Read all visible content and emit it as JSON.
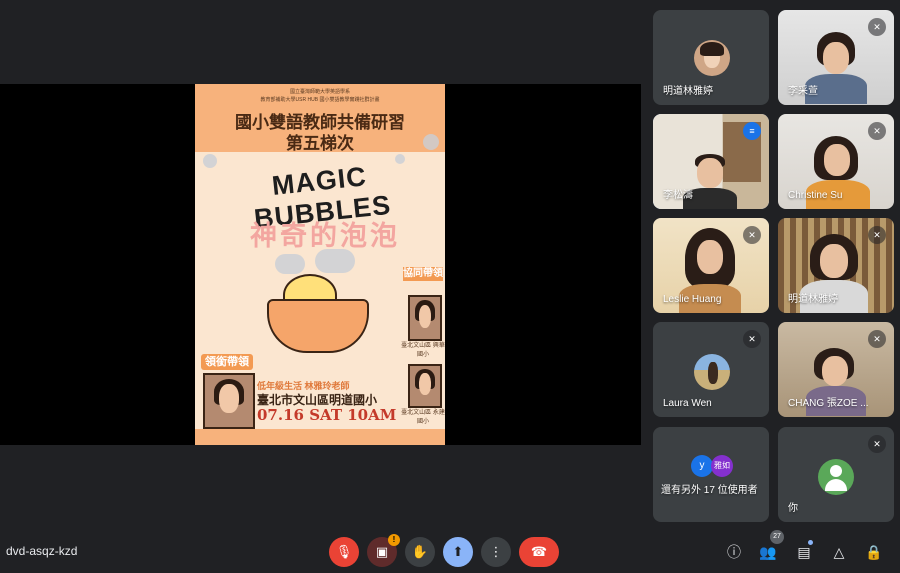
{
  "meeting": {
    "code": "dvd-asqz-kzd",
    "participant_count": "27"
  },
  "poster": {
    "org_lines": [
      "國立臺灣師範大學英語學系",
      "教育部補助大學USR HUB 國小雙語教學實踐社群計畫"
    ],
    "title_line1": "國小雙語教師共備研習",
    "title_line2": "第五梯次",
    "magic": "MAGIC BUBBLES",
    "zh_title": "神奇的泡泡",
    "cohost_label": "協同帶領",
    "leader_label": "領銜帶領",
    "subject_line": "低年級生活  林雅玲老師",
    "school": "臺北市文山區明道國小",
    "date": "07.16 SAT 10AM",
    "cohost1_caption": "臺北文山區 興華國小",
    "cohost2_caption": "臺北文山區 永建國小"
  },
  "tiles": [
    {
      "name": "明道林雅婷",
      "muted": false,
      "talking": false
    },
    {
      "name": "李采萱",
      "muted": true,
      "talking": false
    },
    {
      "name": "李松濤",
      "muted": false,
      "talking": true
    },
    {
      "name": "Christine Su",
      "muted": true,
      "talking": false
    },
    {
      "name": "Leslie Huang",
      "muted": true,
      "talking": false
    },
    {
      "name": "明道林雅婷",
      "muted": true,
      "talking": false
    },
    {
      "name": "Laura Wen",
      "muted": true,
      "talking": false
    },
    {
      "name": "CHANG 張ZOE ...",
      "muted": true,
      "talking": false
    },
    {
      "name": "還有另外 17 位使用者",
      "muted": false,
      "talking": false,
      "avatars": [
        "y",
        "雅如"
      ]
    },
    {
      "name": "你",
      "muted": true,
      "talking": false
    }
  ],
  "colors": {
    "accent": "#8ab4f8",
    "danger": "#ea4335",
    "tile": "#3c4043",
    "bg": "#202124"
  },
  "controls": {
    "mic": "mic-off-icon",
    "camera": "camera-off-icon",
    "hand": "raise-hand-icon",
    "present": "present-screen-icon",
    "more": "more-options-icon",
    "leave": "leave-call-icon"
  },
  "right_controls": [
    "info-icon",
    "people-icon",
    "chat-icon",
    "activities-icon",
    "host-controls-icon"
  ]
}
